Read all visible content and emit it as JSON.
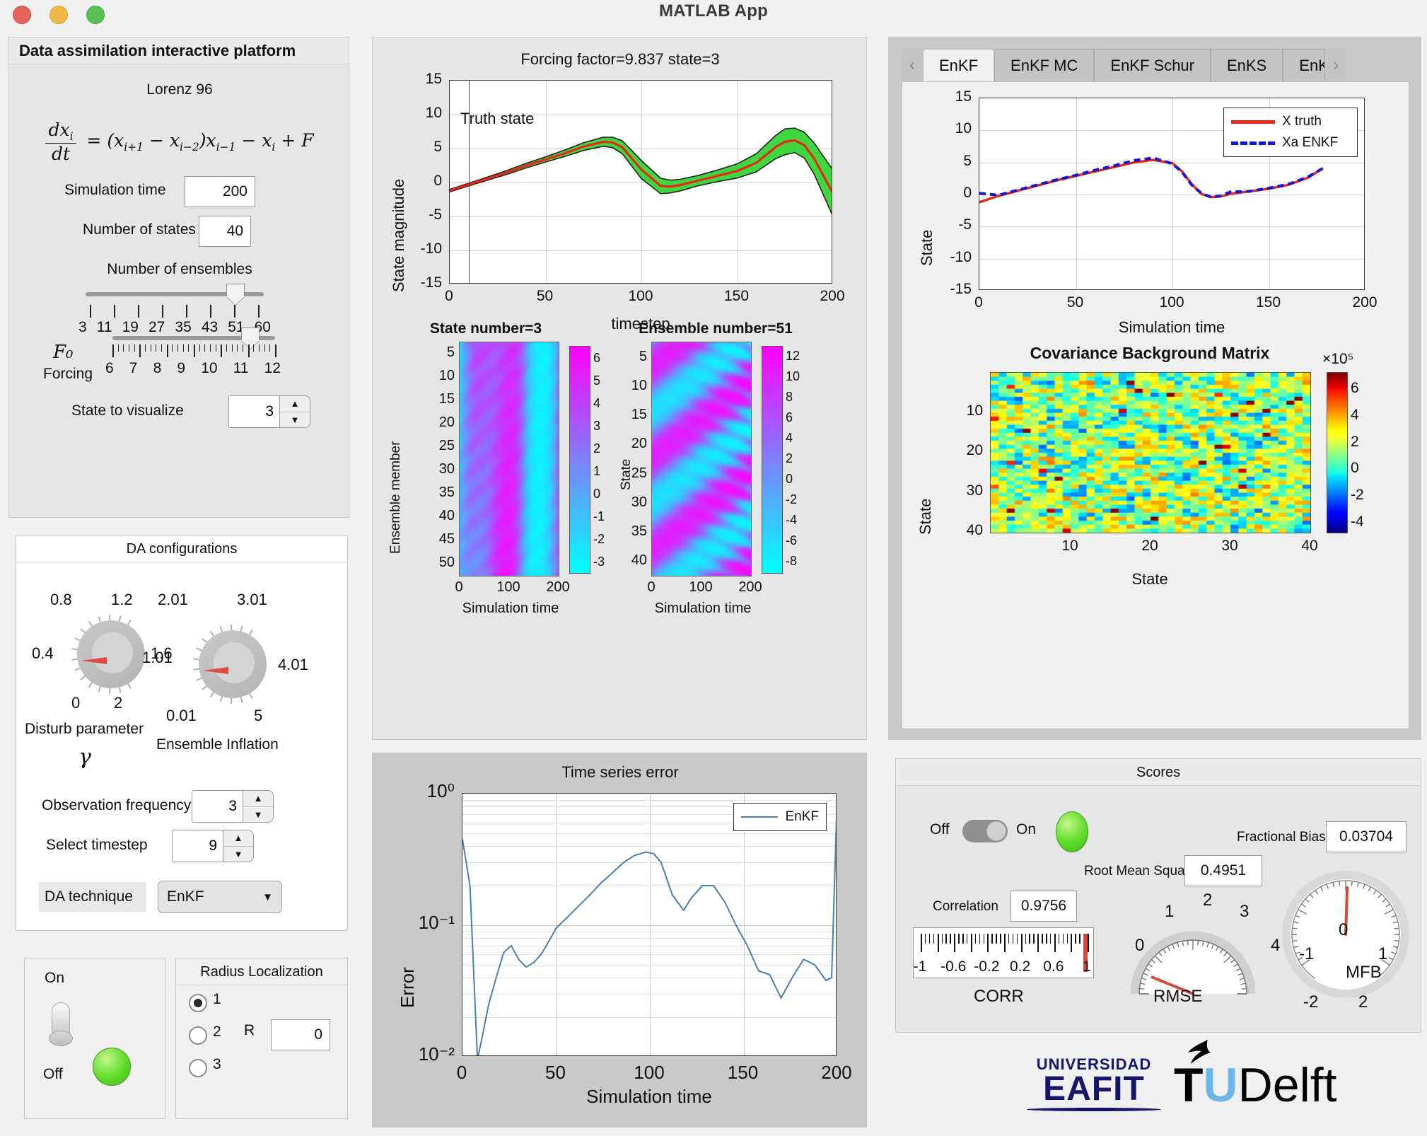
{
  "window": {
    "title": "MATLAB App",
    "controls": [
      "close",
      "minimize",
      "maximize"
    ]
  },
  "left_panel": {
    "title": "Data assimilation interactive platform",
    "model_name": "Lorenz 96",
    "equation": "dx_i/dt = (x_{i+1} - x_{i-2})x_{i-1} - x_i + F",
    "simulation_time": {
      "label": "Simulation time",
      "value": "200"
    },
    "number_of_states": {
      "label": "Number of states",
      "value": "40"
    },
    "ensembles_slider": {
      "label": "Number of ensembles",
      "ticks": [
        "3",
        "11",
        "19",
        "27",
        "35",
        "43",
        "51",
        "60"
      ],
      "value": "51",
      "knob_pct": 77
    },
    "forcing_slider": {
      "label": "Forcing",
      "symbol": "F₀",
      "ticks": [
        "6",
        "7",
        "8",
        "9",
        "10",
        "11",
        "12"
      ],
      "value": "9.837",
      "knob_pct": 63
    },
    "state_to_visualize": {
      "label": "State to visualize",
      "value": "3"
    }
  },
  "da_config": {
    "title": "DA configurations",
    "disturb_knob": {
      "label_line1": "Disturb parameter",
      "label_line2": "γ",
      "ticks": [
        "0.8",
        "1.2",
        "0.4",
        "1.6",
        "0",
        "2"
      ],
      "value": "0.4"
    },
    "inflation_knob": {
      "label": "Ensemble Inflation",
      "ticks": [
        "2.01",
        "3.01",
        "1.01",
        "4.01",
        "0.01",
        "5"
      ],
      "value": "1.01"
    },
    "observation_frequency": {
      "label": "Observation frequency",
      "value": "3"
    },
    "select_timestep": {
      "label": "Select timestep",
      "value": "9"
    },
    "da_technique": {
      "label": "DA technique",
      "value": "EnKF"
    }
  },
  "power_panel": {
    "on_label": "On",
    "off_label": "Off",
    "state": "On"
  },
  "radius_panel": {
    "title": "Radius Localization",
    "options": [
      "1",
      "2",
      "3"
    ],
    "selected": "1",
    "r_label": "R",
    "r_value": "0"
  },
  "tabs": {
    "items": [
      "EnKF",
      "EnKF MC",
      "EnKF Schur",
      "EnKS",
      "EnKS"
    ],
    "active": "EnKF",
    "prev_arrow": "‹",
    "next_arrow": "›"
  },
  "scores": {
    "title": "Scores",
    "toggle_off": "Off",
    "toggle_on": "On",
    "fractional_bias": {
      "label": "Fractional Bias",
      "value": "0.03704"
    },
    "root_mean_square": {
      "label": "Root Mean Square",
      "value": "0.4951"
    },
    "correlation": {
      "label": "Correlation",
      "value": "0.9756"
    },
    "corr_gauge": {
      "name": "CORR",
      "ticks": [
        "-1",
        "-0.6",
        "-0.2",
        "0.2",
        "0.6",
        "1"
      ],
      "value": 0.9756
    },
    "rmse_gauge": {
      "name": "RMSE",
      "ticks": [
        "0",
        "1",
        "2",
        "3",
        "4"
      ],
      "value": 0.4951
    },
    "mfb_gauge": {
      "name": "MFB",
      "ticks": [
        "0",
        "-1",
        "1",
        "-2",
        "2"
      ],
      "value": 0.03704
    }
  },
  "logos": {
    "eafit_line1": "UNIVERSIDAD",
    "eafit_line2": "EAFIT",
    "tud_t": "T",
    "tud_u": "U",
    "tud_rest": "Delft"
  },
  "chart_data": [
    {
      "id": "truth_state",
      "type": "line",
      "title": "Forcing factor=9.837 state=3",
      "annotation": "Truth state",
      "xlabel": "timestep",
      "ylabel": "State magnitude",
      "xlim": [
        0,
        200
      ],
      "ylim": [
        -15,
        15
      ],
      "xticks": [
        0,
        50,
        100,
        150,
        200
      ],
      "yticks": [
        -15,
        -10,
        -5,
        0,
        5,
        10,
        15
      ],
      "grid": true,
      "series": [
        {
          "name": "Truth",
          "color": "#e8261c",
          "x": [
            0,
            10,
            20,
            30,
            40,
            50,
            60,
            70,
            80,
            85,
            90,
            100,
            110,
            115,
            120,
            130,
            140,
            150,
            160,
            170,
            175,
            180,
            185,
            190,
            195,
            200
          ],
          "y": [
            -1.2,
            -0.3,
            0.6,
            1.5,
            2.5,
            3.4,
            4.3,
            5.3,
            6.0,
            5.9,
            5.2,
            1.9,
            -0.5,
            -0.6,
            -0.4,
            0.3,
            1.0,
            1.7,
            2.9,
            5.2,
            6.0,
            6.2,
            5.5,
            3.6,
            1.0,
            -1.6
          ]
        },
        {
          "name": "Ensemble spread",
          "color": "#3fd63f",
          "spread": [
            0.1,
            0.1,
            0.12,
            0.15,
            0.18,
            0.2,
            0.25,
            0.3,
            0.35,
            0.4,
            0.5,
            0.7,
            0.6,
            0.5,
            0.45,
            0.4,
            0.45,
            0.55,
            0.7,
            0.9,
            1.0,
            0.95,
            1.0,
            1.2,
            1.5,
            1.8
          ]
        }
      ]
    },
    {
      "id": "state_number_heatmap",
      "type": "heatmap",
      "title": "State number=3",
      "xlabel": "Simulation time",
      "ylabel": "Ensemble member",
      "xticks": [
        0,
        100,
        200
      ],
      "yticks": [
        5,
        10,
        15,
        20,
        25,
        30,
        35,
        40,
        45,
        50
      ],
      "colorbar_ticks": [
        "6",
        "5",
        "4",
        "3",
        "2",
        "1",
        "0",
        "-1",
        "-2",
        "-3"
      ],
      "cmin": -3.6,
      "cmax": 6.7,
      "colormap": "cool"
    },
    {
      "id": "ensemble_number_heatmap",
      "type": "heatmap",
      "title": "Ensemble number=51",
      "xlabel": "Simulation time",
      "ylabel": "State",
      "xticks": [
        0,
        100,
        200
      ],
      "yticks": [
        5,
        10,
        15,
        20,
        25,
        30,
        35,
        40
      ],
      "colorbar_ticks": [
        "12",
        "10",
        "8",
        "6",
        "4",
        "2",
        "0",
        "-2",
        "-4",
        "-6",
        "-8"
      ],
      "cmin": -9,
      "cmax": 13,
      "colormap": "cool"
    },
    {
      "id": "enkf_state",
      "type": "line",
      "title": "",
      "xlabel": "Simulation time",
      "ylabel": "State",
      "xlim": [
        0,
        200
      ],
      "ylim": [
        -15,
        15
      ],
      "xticks": [
        0,
        50,
        100,
        150,
        200
      ],
      "yticks": [
        -15,
        -10,
        -5,
        0,
        5,
        10,
        15
      ],
      "grid": true,
      "legend": [
        "X truth",
        "Xa ENKF"
      ],
      "legend_position": "top-right",
      "series": [
        {
          "name": "X truth",
          "color": "#e8261c",
          "style": "solid",
          "x": [
            0,
            10,
            20,
            30,
            40,
            50,
            60,
            70,
            80,
            90,
            100,
            105,
            110,
            115,
            120,
            125,
            130,
            140,
            150,
            160,
            170,
            178
          ],
          "y": [
            -1.2,
            -0.2,
            0.6,
            1.4,
            2.2,
            2.9,
            3.6,
            4.3,
            5.0,
            5.4,
            4.9,
            3.6,
            1.6,
            0.1,
            -0.4,
            -0.3,
            0.1,
            0.5,
            0.9,
            1.5,
            2.6,
            4.1
          ]
        },
        {
          "name": "Xa ENKF",
          "color": "#1414d6",
          "style": "dashed",
          "x": [
            0,
            10,
            20,
            30,
            40,
            50,
            60,
            70,
            80,
            90,
            100,
            105,
            110,
            115,
            120,
            125,
            130,
            140,
            150,
            160,
            170,
            178
          ],
          "y": [
            0.2,
            -0.1,
            0.7,
            1.5,
            2.3,
            3.0,
            3.8,
            4.5,
            5.3,
            5.7,
            4.8,
            3.5,
            1.5,
            0.2,
            -0.4,
            -0.2,
            0.4,
            0.5,
            1.0,
            1.6,
            2.7,
            4.1
          ]
        }
      ]
    },
    {
      "id": "covariance_background_matrix",
      "type": "heatmap",
      "title": "Covariance Background Matrix",
      "xlabel": "State",
      "ylabel": "State",
      "xticks": [
        10,
        20,
        30,
        40
      ],
      "yticks": [
        10,
        20,
        30,
        40
      ],
      "colorbar_exponent": "×10⁵",
      "colorbar_ticks": [
        "6",
        "4",
        "2",
        "0",
        "-2",
        "-4"
      ],
      "cmin": -4.5,
      "cmax": 6.8,
      "colormap": "jet",
      "size": [
        40,
        40
      ]
    },
    {
      "id": "time_series_error",
      "type": "line",
      "title": "Time series error",
      "xlabel": "Simulation time",
      "ylabel": "Error",
      "xlim": [
        0,
        200
      ],
      "ylim": [
        0.01,
        1
      ],
      "yscale": "log",
      "xticks": [
        0,
        50,
        100,
        150,
        200
      ],
      "yticks": [
        "10⁰",
        "10⁻¹",
        "10⁻²"
      ],
      "grid": true,
      "legend": [
        "EnKF"
      ],
      "series": [
        {
          "name": "EnKF",
          "color": "#4a7fae",
          "x": [
            0,
            4,
            8,
            10,
            14,
            18,
            22,
            26,
            30,
            34,
            38,
            42,
            46,
            50,
            56,
            62,
            68,
            74,
            80,
            86,
            92,
            98,
            102,
            106,
            112,
            118,
            122,
            128,
            134,
            140,
            146,
            152,
            158,
            164,
            170,
            176,
            182,
            188,
            194,
            197,
            200
          ],
          "y": [
            0.45,
            0.2,
            0.009,
            0.013,
            0.025,
            0.04,
            0.062,
            0.07,
            0.055,
            0.048,
            0.052,
            0.06,
            0.075,
            0.095,
            0.115,
            0.14,
            0.17,
            0.21,
            0.25,
            0.3,
            0.34,
            0.36,
            0.35,
            0.3,
            0.17,
            0.13,
            0.16,
            0.2,
            0.2,
            0.15,
            0.1,
            0.07,
            0.045,
            0.042,
            0.028,
            0.04,
            0.055,
            0.05,
            0.038,
            0.04,
            1.0
          ]
        }
      ]
    }
  ]
}
